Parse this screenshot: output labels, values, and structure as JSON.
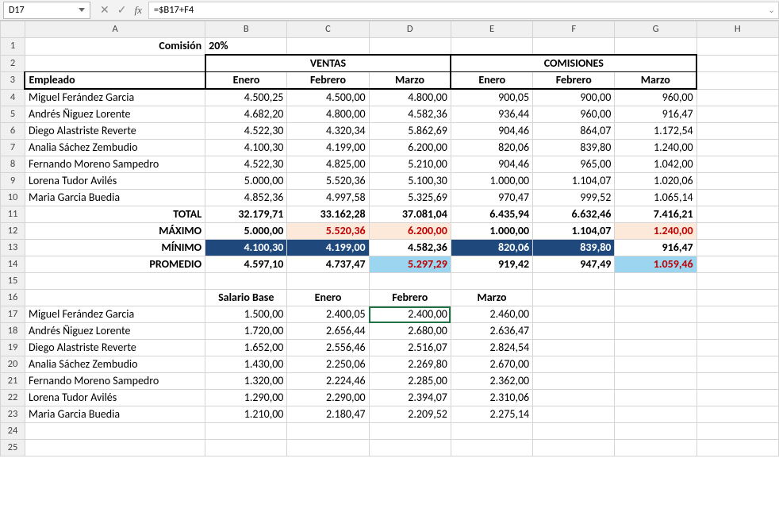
{
  "namebox": "D17",
  "formula": "=$B17+F4",
  "columns": [
    "A",
    "B",
    "C",
    "D",
    "E",
    "F",
    "G",
    "H"
  ],
  "row1": {
    "comision_lbl": "Comisión",
    "comision_val": "20%"
  },
  "hdr": {
    "ventas": "VENTAS",
    "comisiones": "COMISIONES"
  },
  "sub": {
    "empleado": "Empleado",
    "enero": "Enero",
    "febrero": "Febrero",
    "marzo": "Marzo"
  },
  "emp": [
    "Miguel Ferández Garcia",
    "Andrés Ñiguez Lorente",
    "Diego Alastriste Reverte",
    "Analia Sáchez Zembudio",
    "Fernando Moreno Sampedro",
    "Lorena Tudor Avilés",
    "Maria Garcia Buedia"
  ],
  "ventas": [
    [
      "4.500,25",
      "4.500,00",
      "4.800,00"
    ],
    [
      "4.682,20",
      "4.800,00",
      "4.582,36"
    ],
    [
      "4.522,30",
      "4.320,34",
      "5.862,69"
    ],
    [
      "4.100,30",
      "4.199,00",
      "6.200,00"
    ],
    [
      "4.522,30",
      "4.825,00",
      "5.210,00"
    ],
    [
      "5.000,00",
      "5.520,36",
      "5.100,30"
    ],
    [
      "4.852,36",
      "4.997,58",
      "5.325,69"
    ]
  ],
  "comisiones": [
    [
      "900,05",
      "900,00",
      "960,00"
    ],
    [
      "936,44",
      "960,00",
      "916,47"
    ],
    [
      "904,46",
      "864,07",
      "1.172,54"
    ],
    [
      "820,06",
      "839,80",
      "1.240,00"
    ],
    [
      "904,46",
      "965,00",
      "1.042,00"
    ],
    [
      "1.000,00",
      "1.104,07",
      "1.020,06"
    ],
    [
      "970,47",
      "999,52",
      "1.065,14"
    ]
  ],
  "summary": {
    "total_lbl": "TOTAL",
    "total": [
      "32.179,71",
      "33.162,28",
      "37.081,04",
      "6.435,94",
      "6.632,46",
      "7.416,21"
    ],
    "max_lbl": "MÁXIMO",
    "max": [
      "5.000,00",
      "5.520,36",
      "6.200,00",
      "1.000,00",
      "1.104,07",
      "1.240,00"
    ],
    "min_lbl": "MÍNIMO",
    "min": [
      "4.100,30",
      "4.199,00",
      "4.582,36",
      "820,06",
      "839,80",
      "916,47"
    ],
    "avg_lbl": "PROMEDIO",
    "avg": [
      "4.597,10",
      "4.737,47",
      "5.297,29",
      "919,42",
      "947,49",
      "1.059,46"
    ]
  },
  "tbl2hdr": {
    "salario": "Salario Base",
    "enero": "Enero",
    "febrero": "Febrero",
    "marzo": "Marzo"
  },
  "tbl2": [
    [
      "1.500,00",
      "2.400,05",
      "2.400,00",
      "2.460,00"
    ],
    [
      "1.720,00",
      "2.656,44",
      "2.680,00",
      "2.636,47"
    ],
    [
      "1.652,00",
      "2.556,46",
      "2.516,07",
      "2.824,54"
    ],
    [
      "1.430,00",
      "2.250,06",
      "2.269,80",
      "2.670,00"
    ],
    [
      "1.320,00",
      "2.224,46",
      "2.285,00",
      "2.362,00"
    ],
    [
      "1.290,00",
      "2.290,00",
      "2.394,07",
      "2.310,06"
    ],
    [
      "1.210,00",
      "2.180,47",
      "2.209,52",
      "2.275,14"
    ]
  ]
}
